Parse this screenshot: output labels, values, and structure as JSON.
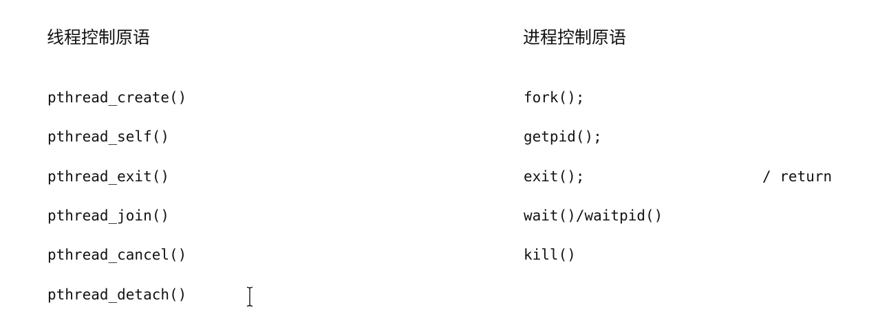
{
  "thread_primitives": {
    "heading": "线程控制原语",
    "items": [
      "pthread_create()",
      "pthread_self()",
      "pthread_exit()",
      "pthread_join()",
      "pthread_cancel()",
      "pthread_detach()"
    ]
  },
  "process_primitives": {
    "heading": "进程控制原语",
    "items": [
      "fork();",
      "getpid();",
      "exit();",
      "wait()/waitpid()",
      "kill()"
    ],
    "exit_note": "/ return"
  },
  "icons": {
    "cursor": "text-cursor-icon"
  }
}
